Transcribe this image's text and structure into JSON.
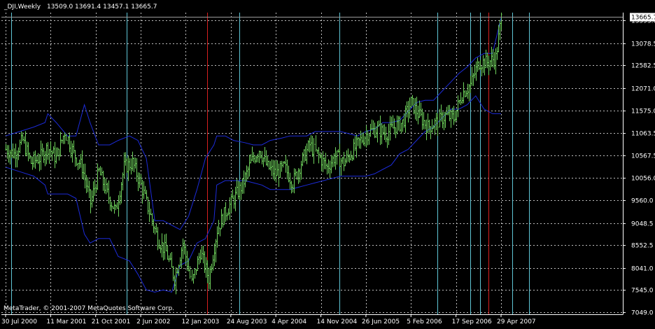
{
  "header": {
    "symbol": "_DJI,Weekly",
    "ohlc": "13509.0 13691.4 13457.1 13665.7"
  },
  "footer": {
    "copyright": "MetaTrader, © 2001-2007 MetaQuotes Software Corp."
  },
  "colors": {
    "background": "#000000",
    "axis": "#ffffff",
    "grid": "#bdbdbd",
    "bars": "#6fd35c",
    "bands": "#1c2bd8",
    "cycle_lines": "#5fc6d6",
    "marker_lines": "#d62020"
  },
  "chart_data": {
    "type": "bar",
    "title": "_DJI,Weekly",
    "current_price": "13665.7",
    "price_labels": [
      "13593.0",
      "13078.5",
      "12582.5",
      "12071.0",
      "11575.0",
      "11063.5",
      "10567.5",
      "10056.0",
      "9560.0",
      "9048.5",
      "8552.5",
      "8041.0",
      "7545.0",
      "7049.0"
    ],
    "date_labels": [
      "30 Jul 2000",
      "11 Mar 2001",
      "21 Oct 2001",
      "2 Jun 2002",
      "12 Jan 2003",
      "24 Aug 2003",
      "4 Apr 2004",
      "14 Nov 2004",
      "26 Jun 2005",
      "5 Feb 2006",
      "17 Sep 2006",
      "29 Apr 2007"
    ],
    "ylim": [
      7000,
      13750
    ],
    "grid": true,
    "weeks_total": 360,
    "last_week_index": 352,
    "series": [
      {
        "values": [
          [
            0,
            10700
          ],
          [
            6,
            10600
          ],
          [
            12,
            10900
          ],
          [
            18,
            10400
          ],
          [
            24,
            10500
          ],
          [
            30,
            10750
          ],
          [
            36,
            10500
          ],
          [
            42,
            11100
          ],
          [
            48,
            10600
          ],
          [
            54,
            10300
          ],
          [
            60,
            9500
          ],
          [
            66,
            10200
          ],
          [
            72,
            9700
          ],
          [
            78,
            9300
          ],
          [
            84,
            10300
          ],
          [
            90,
            10400
          ],
          [
            96,
            9900
          ],
          [
            102,
            9300
          ],
          [
            108,
            8700
          ],
          [
            114,
            8400
          ],
          [
            120,
            7800
          ],
          [
            126,
            8600
          ],
          [
            132,
            7700
          ],
          [
            138,
            8400
          ],
          [
            144,
            7800
          ],
          [
            150,
            8900
          ],
          [
            156,
            9300
          ],
          [
            162,
            9600
          ],
          [
            168,
            9900
          ],
          [
            174,
            10400
          ],
          [
            180,
            10700
          ],
          [
            186,
            10300
          ],
          [
            192,
            10150
          ],
          [
            198,
            10300
          ],
          [
            204,
            9950
          ],
          [
            210,
            10400
          ],
          [
            216,
            10800
          ],
          [
            222,
            10550
          ],
          [
            228,
            10300
          ],
          [
            234,
            10550
          ],
          [
            240,
            10400
          ],
          [
            246,
            10650
          ],
          [
            252,
            10900
          ],
          [
            258,
            11100
          ],
          [
            264,
            11150
          ],
          [
            270,
            11050
          ],
          [
            276,
            11200
          ],
          [
            282,
            11300
          ],
          [
            288,
            11750
          ],
          [
            294,
            11450
          ],
          [
            300,
            11200
          ],
          [
            306,
            11300
          ],
          [
            312,
            11450
          ],
          [
            318,
            11400
          ],
          [
            324,
            11950
          ],
          [
            330,
            12150
          ],
          [
            336,
            12650
          ],
          [
            342,
            12650
          ],
          [
            348,
            12750
          ],
          [
            352,
            13650
          ]
        ]
      },
      {
        "values": [
          [
            0,
            11000
          ],
          [
            10,
            11100
          ],
          [
            20,
            11200
          ],
          [
            28,
            11300
          ],
          [
            30,
            11500
          ],
          [
            36,
            11300
          ],
          [
            44,
            11000
          ],
          [
            50,
            11000
          ],
          [
            56,
            11700
          ],
          [
            60,
            11300
          ],
          [
            66,
            10800
          ],
          [
            74,
            10800
          ],
          [
            80,
            10900
          ],
          [
            88,
            11000
          ],
          [
            94,
            10900
          ],
          [
            100,
            10500
          ],
          [
            106,
            9100
          ],
          [
            112,
            9100
          ],
          [
            118,
            9000
          ],
          [
            124,
            8900
          ],
          [
            130,
            9200
          ],
          [
            136,
            9800
          ],
          [
            142,
            10500
          ],
          [
            148,
            10800
          ],
          [
            150,
            11000
          ],
          [
            156,
            11000
          ],
          [
            162,
            10900
          ],
          [
            170,
            10850
          ],
          [
            176,
            10800
          ],
          [
            182,
            10800
          ],
          [
            188,
            10900
          ],
          [
            196,
            10950
          ],
          [
            202,
            11000
          ],
          [
            208,
            11000
          ],
          [
            214,
            11000
          ],
          [
            220,
            11100
          ],
          [
            226,
            11100
          ],
          [
            232,
            11100
          ],
          [
            238,
            11100
          ],
          [
            244,
            11050
          ],
          [
            250,
            11000
          ],
          [
            256,
            11100
          ],
          [
            262,
            11150
          ],
          [
            268,
            11300
          ],
          [
            274,
            11300
          ],
          [
            280,
            11350
          ],
          [
            286,
            11550
          ],
          [
            292,
            11750
          ],
          [
            298,
            11800
          ],
          [
            304,
            11800
          ],
          [
            310,
            12000
          ],
          [
            316,
            12200
          ],
          [
            322,
            12400
          ],
          [
            328,
            12550
          ],
          [
            334,
            12750
          ],
          [
            340,
            12850
          ],
          [
            346,
            12850
          ],
          [
            352,
            13650
          ]
        ]
      },
      {
        "values": [
          [
            0,
            10300
          ],
          [
            10,
            10200
          ],
          [
            20,
            10100
          ],
          [
            28,
            9900
          ],
          [
            30,
            9700
          ],
          [
            36,
            9700
          ],
          [
            44,
            9700
          ],
          [
            50,
            9600
          ],
          [
            56,
            8800
          ],
          [
            60,
            8600
          ],
          [
            66,
            8700
          ],
          [
            74,
            8700
          ],
          [
            80,
            8300
          ],
          [
            88,
            8200
          ],
          [
            94,
            7900
          ],
          [
            100,
            7550
          ],
          [
            106,
            7500
          ],
          [
            112,
            7550
          ],
          [
            118,
            7500
          ],
          [
            124,
            8100
          ],
          [
            130,
            8200
          ],
          [
            136,
            8600
          ],
          [
            142,
            8700
          ],
          [
            148,
            9100
          ],
          [
            150,
            9900
          ],
          [
            156,
            10000
          ],
          [
            162,
            10000
          ],
          [
            170,
            10000
          ],
          [
            176,
            9950
          ],
          [
            182,
            9900
          ],
          [
            188,
            9800
          ],
          [
            196,
            9800
          ],
          [
            202,
            9800
          ],
          [
            208,
            9850
          ],
          [
            214,
            9900
          ],
          [
            220,
            9950
          ],
          [
            226,
            10000
          ],
          [
            232,
            10050
          ],
          [
            238,
            10100
          ],
          [
            244,
            10100
          ],
          [
            250,
            10100
          ],
          [
            256,
            10100
          ],
          [
            262,
            10150
          ],
          [
            268,
            10250
          ],
          [
            274,
            10350
          ],
          [
            280,
            10600
          ],
          [
            286,
            10700
          ],
          [
            292,
            10900
          ],
          [
            298,
            11100
          ],
          [
            304,
            11200
          ],
          [
            310,
            11400
          ],
          [
            316,
            11600
          ],
          [
            322,
            11600
          ],
          [
            328,
            11700
          ],
          [
            334,
            11900
          ],
          [
            340,
            11600
          ],
          [
            346,
            11500
          ],
          [
            352,
            11500
          ]
        ]
      }
    ],
    "cycle_line_weeks": [
      4,
      86,
      166,
      237,
      307,
      372,
      330,
      337,
      360
    ],
    "marker_line_weeks": [
      143,
      343
    ]
  }
}
